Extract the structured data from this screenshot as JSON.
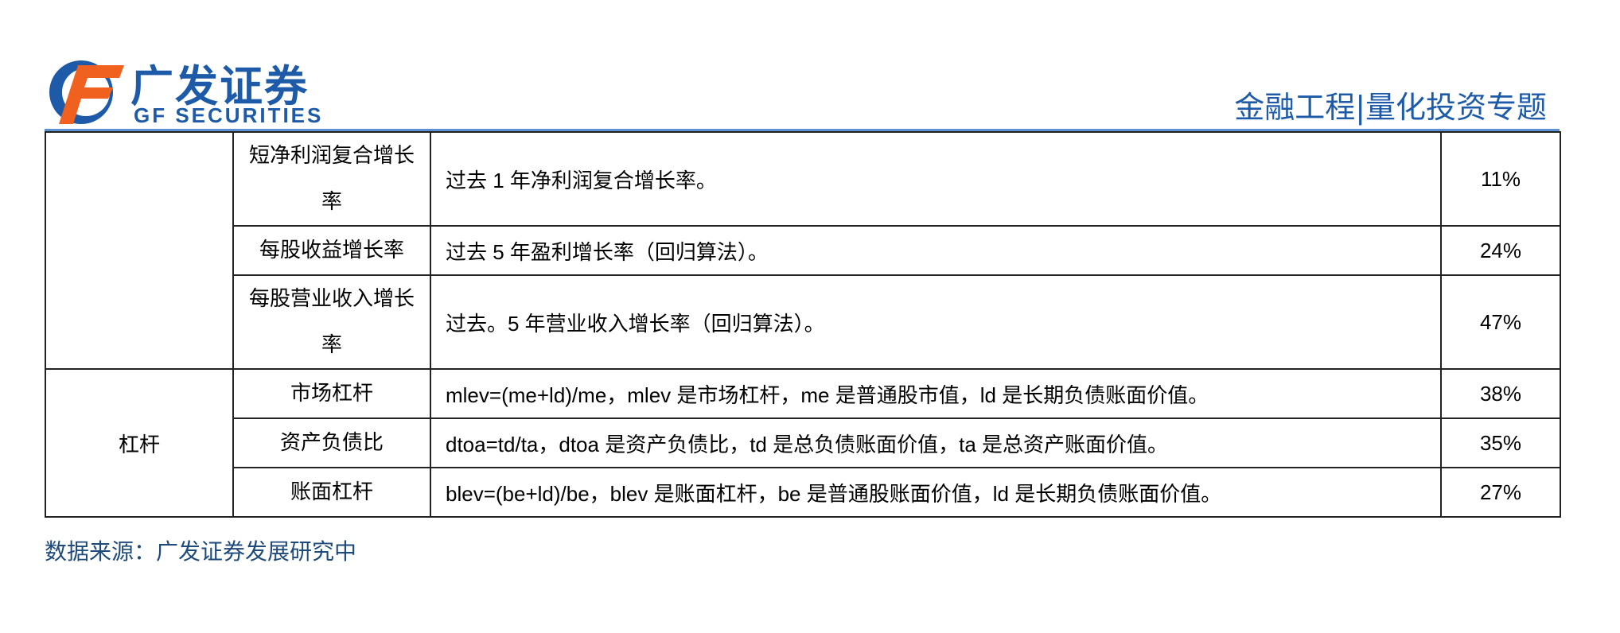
{
  "header": {
    "logo_cn": "广发证券",
    "logo_en": "GF SECURITIES",
    "title": "金融工程|量化投资专题",
    "brand_colors": {
      "blue": "#1d5aa8",
      "orange": "#f0601e"
    }
  },
  "table": {
    "rows": [
      {
        "name": "短净利润复合增长率",
        "desc": "过去 1 年净利润复合增长率。",
        "value": "11%"
      },
      {
        "name": "每股收益增长率",
        "desc": "过去 5 年盈利增长率（回归算法）。",
        "value": "24%"
      },
      {
        "name": "每股营业收入增长率",
        "desc": "过去。5 年营业收入增长率（回归算法）。",
        "value": "47%"
      },
      {
        "category": "杠杆",
        "name": "市场杠杆",
        "desc": "mlev=(me+ld)/me，mlev 是市场杠杆，me 是普通股市值，ld 是长期负债账面价值。",
        "value": "38%"
      },
      {
        "name": "资产负债比",
        "desc": "dtoa=td/ta，dtoa 是资产负债比，td 是总负债账面价值，ta 是总资产账面价值。",
        "value": "35%"
      },
      {
        "name": "账面杠杆",
        "desc": "blev=(be+ld)/be，blev 是账面杠杆，be 是普通股账面价值，ld 是长期负债账面价值。",
        "value": "27%"
      }
    ]
  },
  "footer": {
    "source": "数据来源：广发证券发展研究中"
  }
}
